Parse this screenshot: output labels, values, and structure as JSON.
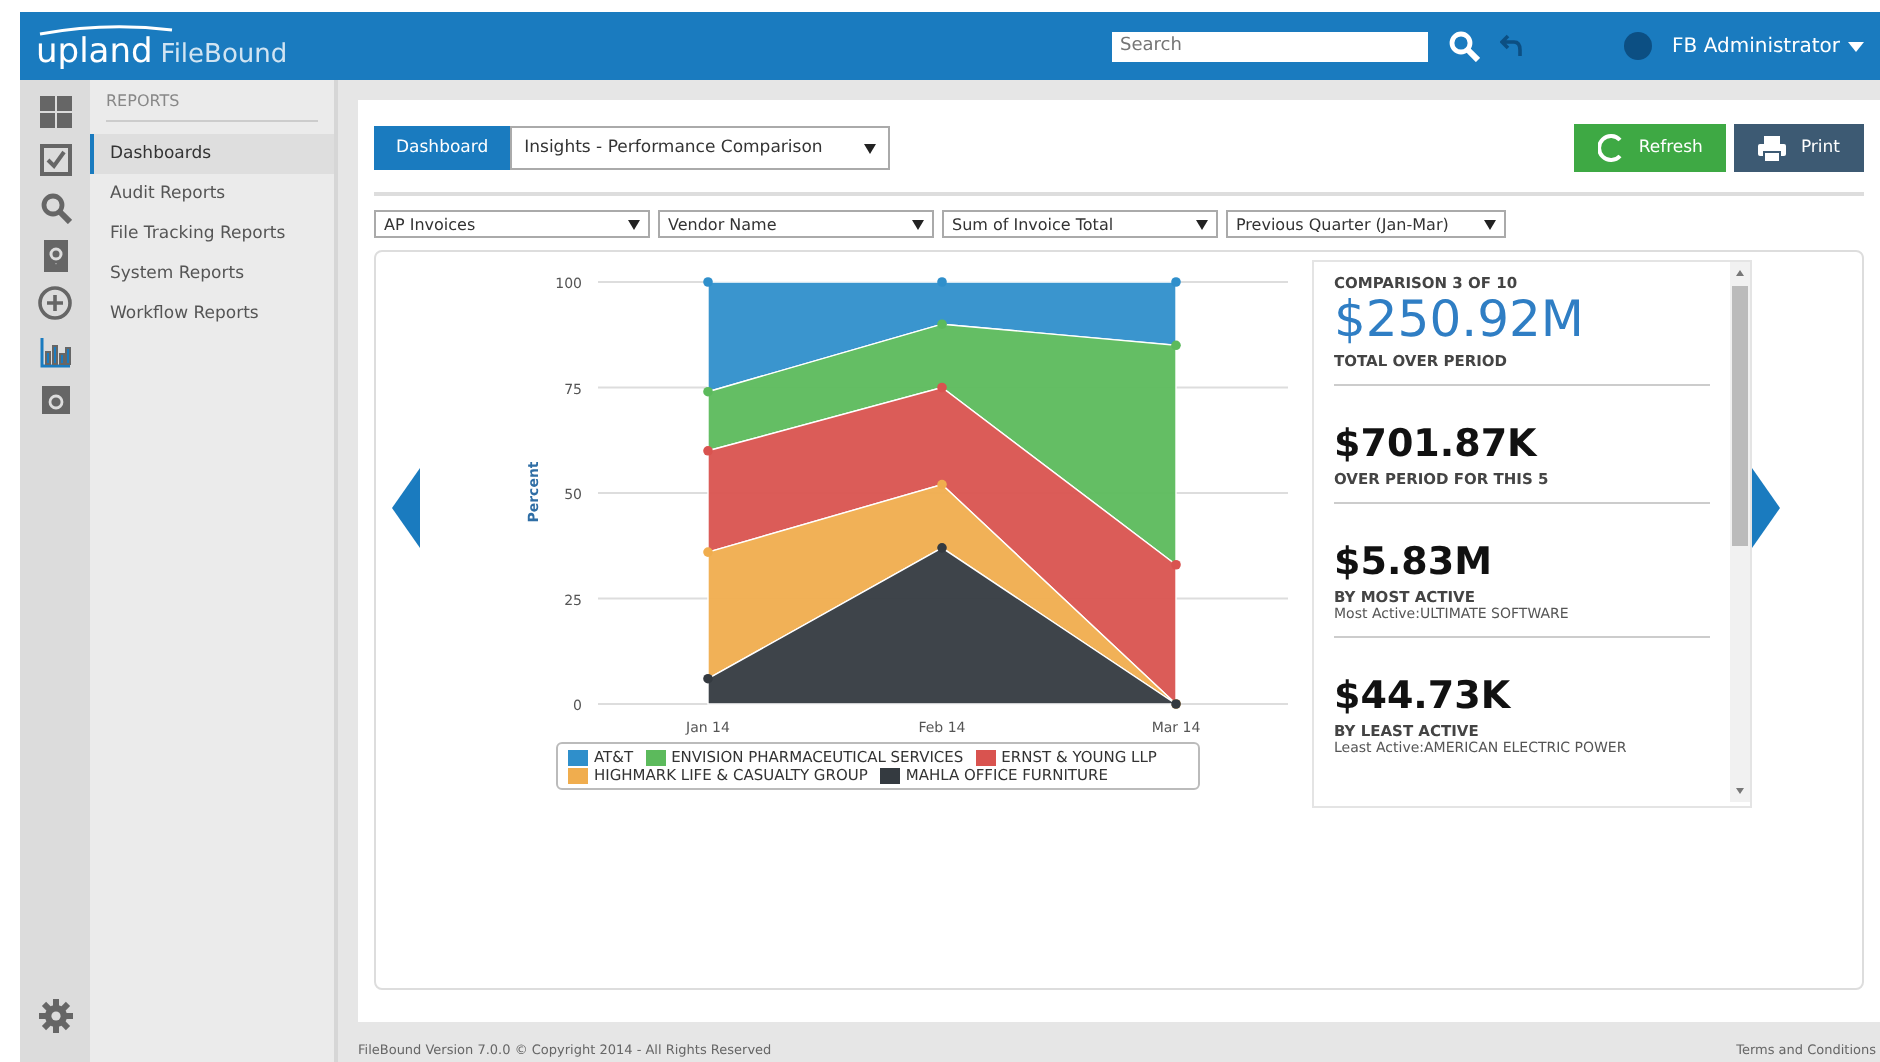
{
  "header": {
    "logo_brand": "upland",
    "logo_product": "FileBound",
    "search": {
      "placeholder": "Search"
    },
    "user": "FB Administrator"
  },
  "rail": [
    {
      "kind": "grid",
      "selected": false
    },
    {
      "kind": "check",
      "selected": false
    },
    {
      "kind": "search",
      "selected": false
    },
    {
      "kind": "help-doc",
      "selected": false
    },
    {
      "kind": "plus",
      "selected": false
    },
    {
      "kind": "chart",
      "selected": true
    },
    {
      "kind": "box",
      "selected": false
    }
  ],
  "sidebar": {
    "heading": "REPORTS",
    "items": [
      {
        "label": "Dashboards",
        "selected": true
      },
      {
        "label": "Audit Reports",
        "selected": false
      },
      {
        "label": "File Tracking Reports",
        "selected": false
      },
      {
        "label": "System Reports",
        "selected": false
      },
      {
        "label": "Workflow Reports",
        "selected": false
      }
    ]
  },
  "toolbar": {
    "tab": "Dashboard",
    "dashboard_select": "Insights - Performance Comparison",
    "buttons": [
      {
        "kind": "refresh",
        "label": "Refresh"
      },
      {
        "kind": "print",
        "label": "Print"
      }
    ]
  },
  "filters": [
    "AP Invoices",
    "Vendor Name",
    "Sum of Invoice Total",
    "Previous Quarter (Jan-Mar)"
  ],
  "chart_data": {
    "type": "area",
    "stacked": true,
    "ylabel": "Percent",
    "categories": [
      "Jan 14",
      "Feb 14",
      "Mar 14"
    ],
    "ylim": [
      0,
      100
    ],
    "grid": true,
    "legend": true,
    "yticks": [
      0,
      25,
      50,
      75,
      100
    ],
    "series": [
      {
        "name": "AT&T",
        "color": "#2f8fcb",
        "values": [
          26,
          10,
          15
        ]
      },
      {
        "name": "ENVISION PHARMACEUTICAL SERVICES",
        "color": "#5cba5c",
        "values": [
          14,
          15,
          52
        ]
      },
      {
        "name": "ERNST & YOUNG LLP",
        "color": "#d9534f",
        "values": [
          24,
          23,
          33
        ]
      },
      {
        "name": "HIGHMARK LIFE & CASUALTY GROUP",
        "color": "#f0ad4e",
        "values": [
          30,
          15,
          0
        ]
      },
      {
        "name": "MAHLA OFFICE FURNITURE",
        "color": "#343a40",
        "values": [
          6,
          37,
          0
        ]
      }
    ]
  },
  "stats": {
    "caption": "COMPARISON 3 OF 10",
    "items": [
      {
        "value": "$250.92M",
        "label": "TOTAL OVER PERIOD",
        "highlight": true
      },
      {
        "value": "$701.87K",
        "label": "OVER PERIOD FOR THIS 5",
        "highlight": false
      },
      {
        "value": "$5.83M",
        "label": "BY MOST ACTIVE",
        "detail": "Most Active:ULTIMATE SOFTWARE",
        "highlight": false
      },
      {
        "value": "$44.73K",
        "label": "BY LEAST ACTIVE",
        "detail": "Least Active:AMERICAN ELECTRIC POWER",
        "highlight": false
      }
    ]
  },
  "footer": {
    "copyright": "FileBound Version 7.0.0 © Copyright 2014 - All Rights Reserved",
    "terms": "Terms and Conditions"
  }
}
